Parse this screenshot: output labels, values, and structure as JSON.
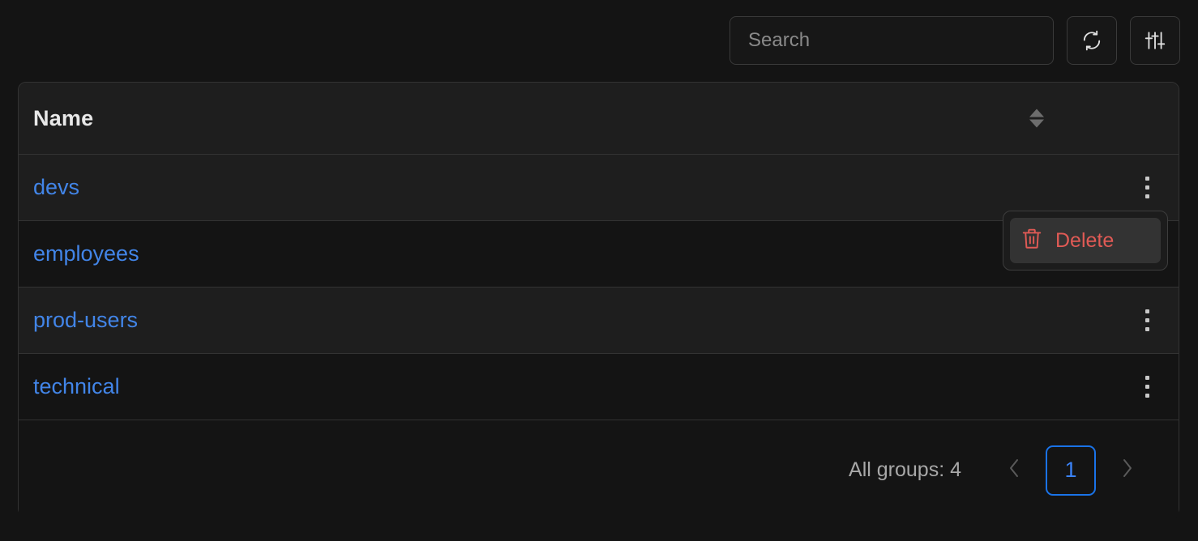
{
  "toolbar": {
    "search_placeholder": "Search",
    "search_value": "",
    "refresh_title": "Refresh",
    "filter_title": "Filter"
  },
  "table": {
    "columns": [
      {
        "label": "Name",
        "sortable": true
      }
    ],
    "rows": [
      {
        "name": "devs"
      },
      {
        "name": "employees"
      },
      {
        "name": "prod-users"
      },
      {
        "name": "technical"
      }
    ]
  },
  "context_menu": {
    "open_for_row": "employees",
    "items": [
      {
        "label": "Delete",
        "icon": "trash-icon",
        "color": "#e05a55"
      }
    ]
  },
  "footer": {
    "total_label": "All groups: 4",
    "prev_label": "‹",
    "next_label": "›",
    "current_page": "1"
  },
  "colors": {
    "background": "#141414",
    "row_alt": "#1e1e1e",
    "border": "#333333",
    "link": "#4285e8",
    "accent_blue": "#1a73e8",
    "danger": "#e05a55",
    "muted_text": "#a8a8a8"
  }
}
